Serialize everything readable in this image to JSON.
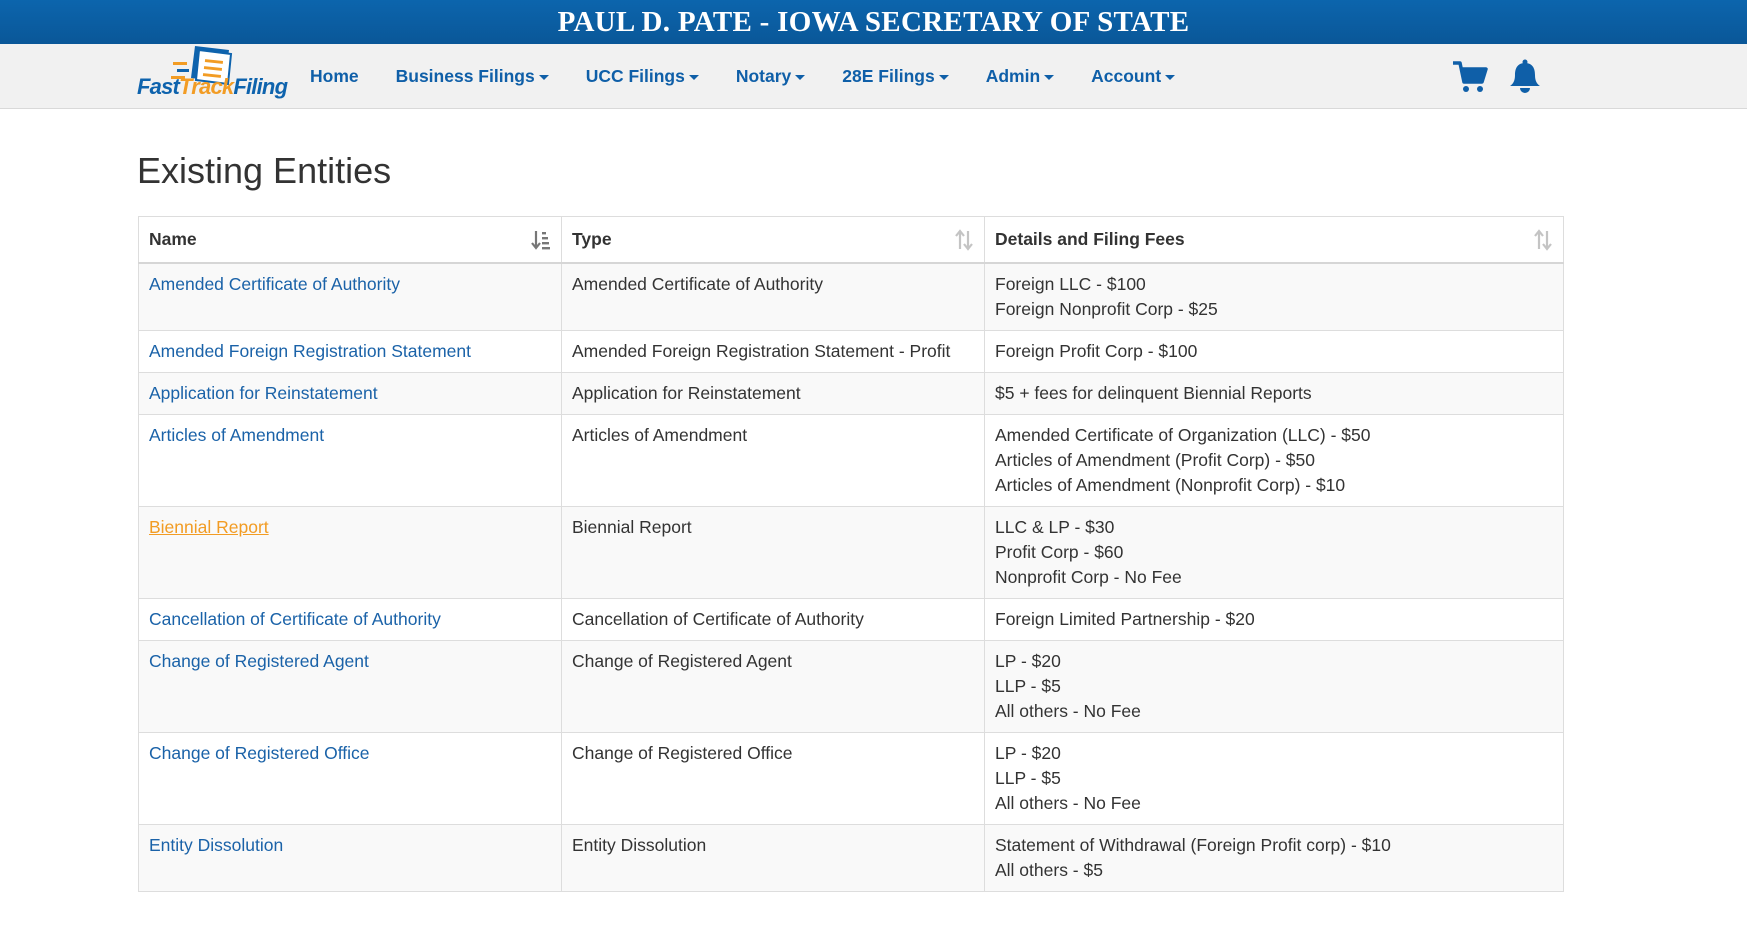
{
  "banner": {
    "title": "PAUL D. PATE - IOWA SECRETARY OF STATE"
  },
  "logo": {
    "part1": "Fast",
    "part2": "Track",
    "part3": "Filing"
  },
  "nav": [
    {
      "label": "Home",
      "dropdown": false
    },
    {
      "label": "Business Filings",
      "dropdown": true
    },
    {
      "label": "UCC Filings",
      "dropdown": true
    },
    {
      "label": "Notary",
      "dropdown": true
    },
    {
      "label": "28E Filings",
      "dropdown": true
    },
    {
      "label": "Admin",
      "dropdown": true
    },
    {
      "label": "Account",
      "dropdown": true
    }
  ],
  "icons": {
    "cart": "shopping-cart-icon",
    "bell": "notification-bell-icon",
    "accent": "#0f5fa8",
    "link_active": "#f29c24"
  },
  "page": {
    "title": "Existing Entities"
  },
  "table": {
    "headers": [
      "Name",
      "Type",
      "Details and Filing Fees"
    ],
    "rows": [
      {
        "name": "Amended Certificate of Authority",
        "type": "Amended Certificate of Authority",
        "fees": [
          "Foreign LLC - $100",
          "Foreign Nonprofit Corp - $25"
        ]
      },
      {
        "name": "Amended Foreign Registration Statement",
        "type": "Amended Foreign Registration Statement - Profit",
        "fees": [
          "Foreign Profit Corp - $100"
        ]
      },
      {
        "name": "Application for Reinstatement",
        "type": "Application for Reinstatement",
        "fees": [
          "$5 + fees for delinquent Biennial Reports"
        ]
      },
      {
        "name": "Articles of Amendment",
        "type": "Articles of Amendment",
        "fees": [
          "Amended Certificate of Organization (LLC) - $50",
          "Articles of Amendment (Profit Corp) - $50",
          "Articles of Amendment (Nonprofit Corp) - $10"
        ]
      },
      {
        "name": "Biennial Report",
        "type": "Biennial Report",
        "fees": [
          "LLC & LP - $30",
          "Profit Corp - $60",
          "Nonprofit Corp - No Fee"
        ],
        "active": true
      },
      {
        "name": "Cancellation of Certificate of Authority",
        "type": "Cancellation of Certificate of Authority",
        "fees": [
          "Foreign Limited Partnership - $20"
        ]
      },
      {
        "name": "Change of Registered Agent",
        "type": "Change of Registered Agent",
        "fees": [
          "LP - $20",
          "LLP - $5",
          "All others - No Fee"
        ]
      },
      {
        "name": "Change of Registered Office",
        "type": "Change of Registered Office",
        "fees": [
          "LP - $20",
          "LLP - $5",
          "All others - No Fee"
        ]
      },
      {
        "name": "Entity Dissolution",
        "type": "Entity Dissolution",
        "fees": [
          "Statement of Withdrawal (Foreign Profit corp) - $10",
          "All others - $5"
        ]
      }
    ]
  }
}
